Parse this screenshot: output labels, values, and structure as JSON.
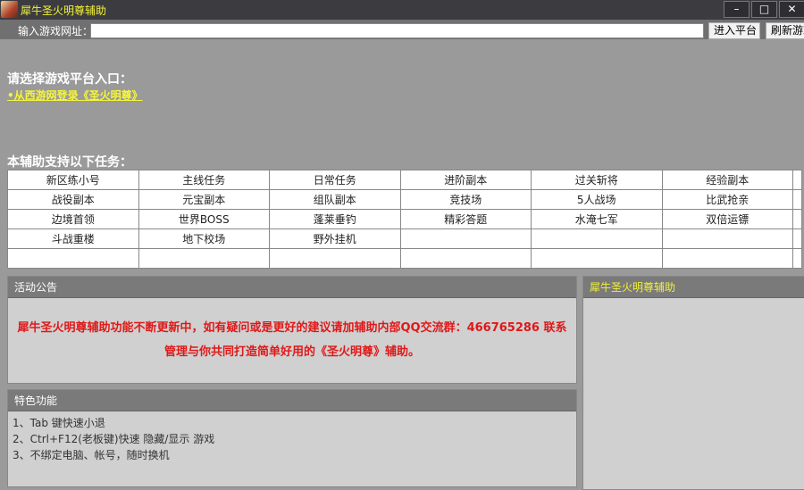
{
  "window": {
    "title": "犀牛圣火明尊辅助",
    "minimize": "–",
    "maximize": "□",
    "close": "✕"
  },
  "url_bar": {
    "label": "输入游戏网址：",
    "value": "",
    "enter_button": "进入平台",
    "refresh_button": "刷新游戏"
  },
  "platform": {
    "heading": "请选择游戏平台入口：",
    "link": "•从西游网登录《圣火明尊》"
  },
  "tasks": {
    "heading": "本辅助支持以下任务：",
    "rows": [
      [
        "新区练小号",
        "主线任务",
        "日常任务",
        "进阶副本",
        "过关斩将",
        "经验副本"
      ],
      [
        "战役副本",
        "元宝副本",
        "组队副本",
        "竞技场",
        "5人战场",
        "比武抢亲"
      ],
      [
        "边境首领",
        "世界BOSS",
        "蓬莱垂钓",
        "精彩答题",
        "水淹七军",
        "双倍运镖"
      ],
      [
        "斗战重楼",
        "地下校场",
        "野外挂机",
        "",
        "",
        ""
      ],
      [
        "",
        "",
        "",
        "",
        "",
        ""
      ]
    ]
  },
  "notice": {
    "header": "活动公告",
    "text": "犀牛圣火明尊辅助功能不断更新中，如有疑问或是更好的建议请加辅助内部QQ交流群：466765286 联系管理与你共同打造简单好用的《圣火明尊》辅助。"
  },
  "features": {
    "header": "特色功能",
    "items": [
      "1、Tab 键快速小退",
      "2、Ctrl+F12(老板键)快速 隐藏/显示 游戏",
      "3、不绑定电脑、帐号，随时换机"
    ]
  },
  "side_panel": {
    "header": "犀牛圣火明尊辅助"
  }
}
